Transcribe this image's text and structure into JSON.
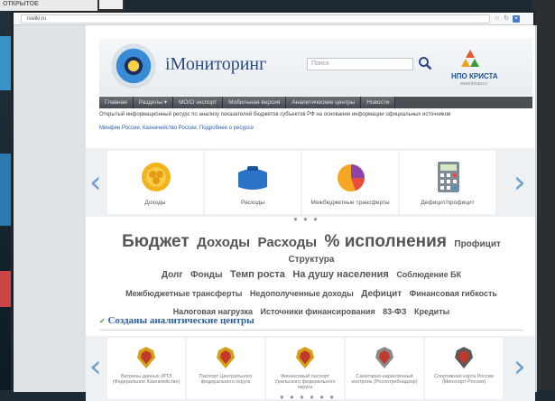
{
  "top_bar": {
    "text": "ОТКРЫТОЕ"
  },
  "browser": {
    "url": "iswiki.ru"
  },
  "site": {
    "logo_text": "iМониторинг",
    "search_placeholder": "Поиск",
    "partner_name": "НПО КРИСТА",
    "partner_sub": "www.krista.ru"
  },
  "nav": {
    "items": [
      "Главная",
      "Разделы ▾",
      "МО/О экспорт",
      "Мобильная версия",
      "Аналитические центры",
      "Новости"
    ]
  },
  "info": {
    "line1": "Открытый информационный ресурс по анализу показателей бюджетов субъектов РФ на основании информации официальных источников",
    "line2": "Минфин России, Казначейство России. Подробнее о ресурсе"
  },
  "carousel1": {
    "cards": [
      {
        "label": "Доходы",
        "icon": "coins-icon"
      },
      {
        "label": "Расходы",
        "icon": "wallet-icon"
      },
      {
        "label": "Межбюджетные трансферты",
        "icon": "pie-chart-icon"
      },
      {
        "label": "Дефицит/профицит",
        "icon": "calculator-icon"
      }
    ],
    "dots": "● ● ●"
  },
  "tag_cloud": {
    "rows": [
      [
        {
          "t": "Бюджет",
          "s": 19
        },
        {
          "t": "Доходы",
          "s": 15
        },
        {
          "t": "Расходы",
          "s": 15
        },
        {
          "t": "% исполнения",
          "s": 19
        },
        {
          "t": "Профицит",
          "s": 10
        },
        {
          "t": "Структура",
          "s": 10
        }
      ],
      [
        {
          "t": "Долг",
          "s": 10
        },
        {
          "t": "Фонды",
          "s": 10
        },
        {
          "t": "Темп роста",
          "s": 11
        },
        {
          "t": "На душу населения",
          "s": 11
        },
        {
          "t": "Соблюдение БК",
          "s": 9
        }
      ],
      [
        {
          "t": "Межбюджетные трансферты",
          "s": 9
        },
        {
          "t": "Недополученные доходы",
          "s": 9
        },
        {
          "t": "Дефицит",
          "s": 10
        },
        {
          "t": "Финансовая гибкость",
          "s": 9
        }
      ],
      [
        {
          "t": "Налоговая нагрузка",
          "s": 9
        },
        {
          "t": "Источники финансирования",
          "s": 9
        },
        {
          "t": "83-ФЗ",
          "s": 9
        },
        {
          "t": "Кредиты",
          "s": 9
        }
      ]
    ]
  },
  "section": {
    "title": "Созданы аналитические центры"
  },
  "carousel2": {
    "cards": [
      {
        "label": "Витрины данных ИПЭ (Федеральное Казначейство)",
        "icon": "eagle-emblem-icon"
      },
      {
        "label": "Паспорт Центрального федерального округа",
        "icon": "eagle-emblem-icon"
      },
      {
        "label": "Финансовый паспорт Уральского федерального округа",
        "icon": "eagle-emblem-icon"
      },
      {
        "label": "Санитарно-карантинный контроль (Роспотребнадзор)",
        "icon": "eagle-emblem-icon"
      },
      {
        "label": "Спортивная карта России (Минспорт России)",
        "icon": "eagle-emblem-icon"
      }
    ],
    "dots": "● ● ● ● ● ●"
  },
  "colors": {
    "accent": "#2c4a87",
    "link": "#2a5db0",
    "arrow": "#6a9ccc",
    "nav_bg": "#4a4f54"
  }
}
